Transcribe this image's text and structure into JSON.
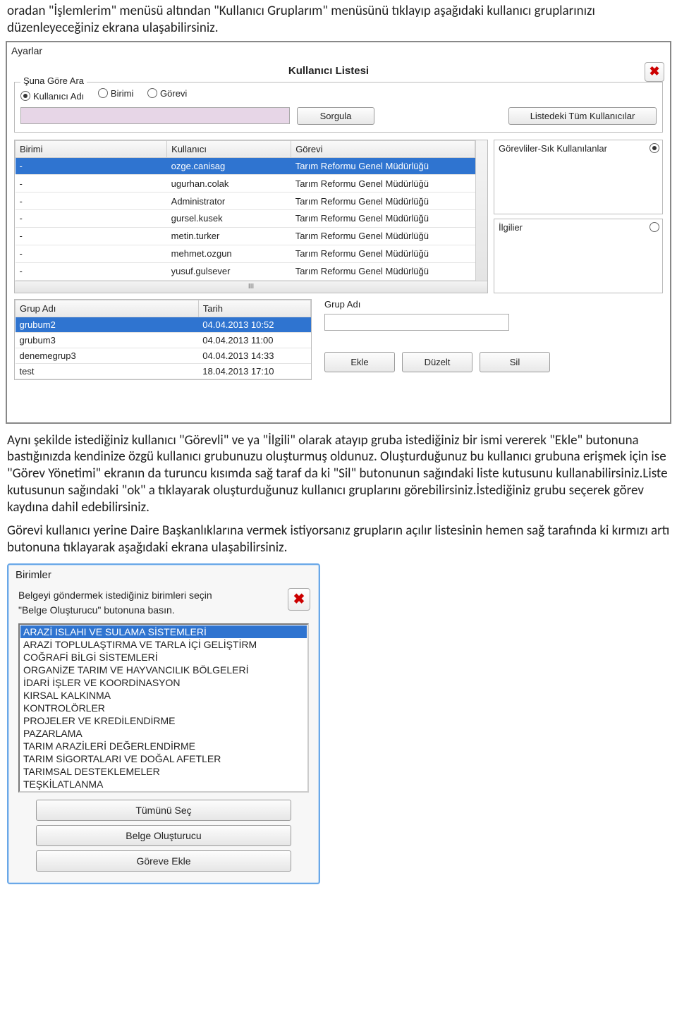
{
  "doc": {
    "para1": "oradan \"İşlemlerim\" menüsü altından \"Kullanıcı Gruplarım\" menüsünü tıklayıp aşağıdaki kullanıcı gruplarınızı düzenleyeceğiniz ekrana ulaşabilirsiniz.",
    "para2": "Aynı şekilde istediğiniz kullanıcı \"Görevli\" ve ya \"İlgili\" olarak atayıp gruba istediğiniz bir ismi vererek \"Ekle\" butonuna bastığınızda kendinize özgü kullanıcı grubunuzu oluşturmuş oldunuz. Oluşturduğunuz bu kullanıcı grubuna erişmek için ise \"Görev Yönetimi\" ekranın da turuncu kısımda sağ taraf da ki \"Sil\" butonunun sağındaki liste kutusunu kullanabilirsiniz.Liste kutusunun sağındaki \"ok\" a tıklayarak oluşturduğunuz kullanıcı gruplarını görebilirsiniz.İstediğiniz grubu seçerek görev kaydına dahil edebilirsiniz.",
    "para3": "Görevi kullanıcı yerine Daire Başkanlıklarına vermek istiyorsanız grupların açılır listesinin hemen sağ tarafında ki kırmızı artı butonuna tıklayarak aşağıdaki ekrana ulaşabilirsiniz."
  },
  "panel1": {
    "window": "Ayarlar",
    "title": "Kullanıcı Listesi",
    "searchLegend": "Şuna Göre Ara",
    "radios": {
      "r1": "Kullanıcı Adı",
      "r2": "Birimi",
      "r3": "Görevi"
    },
    "btnQuery": "Sorgula",
    "btnAll": "Listedeki Tüm Kullanıcılar",
    "cols": {
      "c1": "Birimi",
      "c2": "Kullanıcı",
      "c3": "Görevi"
    },
    "rows": [
      {
        "b": "-",
        "k": "ozge.canisag",
        "g": "Tarım Reformu Genel Müdürlüğü"
      },
      {
        "b": "-",
        "k": "ugurhan.colak",
        "g": "Tarım Reformu Genel Müdürlüğü"
      },
      {
        "b": "-",
        "k": "Administrator",
        "g": "Tarım Reformu Genel Müdürlüğü"
      },
      {
        "b": "-",
        "k": "gursel.kusek",
        "g": "Tarım Reformu Genel Müdürlüğü"
      },
      {
        "b": "-",
        "k": "metin.turker",
        "g": "Tarım Reformu Genel Müdürlüğü"
      },
      {
        "b": "-",
        "k": "mehmet.ozgun",
        "g": "Tarım Reformu Genel Müdürlüğü"
      },
      {
        "b": "-",
        "k": "yusuf.gulsever",
        "g": "Tarım Reformu Genel Müdürlüğü"
      }
    ],
    "side1": "Görevliler-Sık Kullanılanlar",
    "side2": "İlgilier",
    "grpCols": {
      "c1": "Grup Adı",
      "c2": "Tarih"
    },
    "grpRows": [
      {
        "n": "grubum2",
        "t": "04.04.2013 10:52"
      },
      {
        "n": "grubum3",
        "t": "04.04.2013 11:00"
      },
      {
        "n": "denemegrup3",
        "t": "04.04.2013 14:33"
      },
      {
        "n": "test",
        "t": "18.04.2013 17:10"
      }
    ],
    "grpLabel": "Grup Adı",
    "btnAdd": "Ekle",
    "btnEdit": "Düzelt",
    "btnDel": "Sil"
  },
  "panel2": {
    "title": "Birimler",
    "line1": "Belgeyi göndermek istediğiniz birimleri seçin",
    "line2": "\"Belge Oluşturucu\" butonuna basın.",
    "items": [
      "ARAZİ ISLAHI VE SULAMA SİSTEMLERİ",
      "ARAZİ TOPLULAŞTIRMA VE TARLA İÇİ GELİŞTİRM",
      "COĞRAFİ BİLGİ SİSTEMLERİ",
      "ORGANİZE TARIM VE HAYVANCILIK BÖLGELERİ",
      "İDARİ İŞLER VE KOORDİNASYON",
      "KIRSAL KALKINMA",
      "KONTROLÖRLER",
      "PROJELER VE KREDİLENDİRME",
      "PAZARLAMA",
      "TARIM ARAZİLERİ DEĞERLENDİRME",
      "TARIM SİGORTALARI VE DOĞAL AFETLER",
      "TARIMSAL DESTEKLEMELER",
      "TEŞKİLATLANMA"
    ],
    "btnAll": "Tümünü Seç",
    "btnCreate": "Belge Oluşturucu",
    "btnAssign": "Göreve Ekle"
  }
}
